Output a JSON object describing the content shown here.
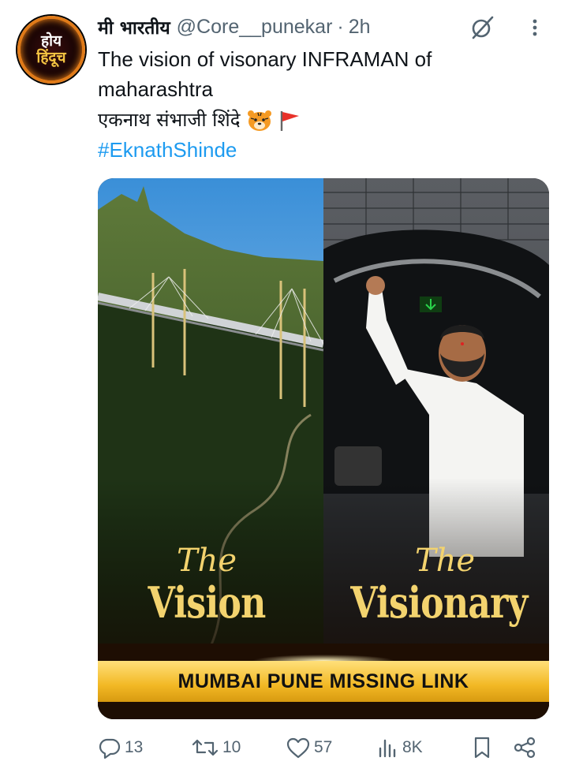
{
  "avatar": {
    "line1": "होय",
    "line2": "हिंदूच"
  },
  "header": {
    "display_name": "मी भारतीय",
    "handle": "@Core__punekar",
    "separator": "·",
    "time": "2h"
  },
  "tweet": {
    "line1": "The vision of visonary INFRAMAN of",
    "line2": "maharashtra",
    "line3": "एकनाथ संभाजी शिंदे",
    "hashtag": "#EknathShinde"
  },
  "media": {
    "left_the": "The",
    "left_title": "Vision",
    "right_the": "The",
    "right_title": "Visionary",
    "banner": "MUMBAI PUNE MISSING LINK"
  },
  "actions": {
    "replies": "13",
    "reposts": "10",
    "likes": "57",
    "views": "8K"
  },
  "colors": {
    "link": "#1d9bf0",
    "muted": "#536471",
    "text": "#0f1419",
    "banner": "#f2b824"
  },
  "icons": [
    "grok-icon",
    "more-icon",
    "tiger-emoji",
    "flag-emoji",
    "reply-icon",
    "repost-icon",
    "like-icon",
    "views-icon",
    "bookmark-icon",
    "share-icon"
  ]
}
